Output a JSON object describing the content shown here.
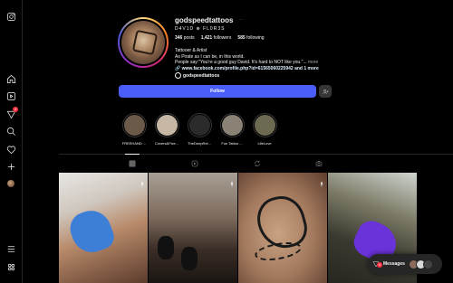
{
  "sidebar": {
    "icons": [
      "instagram-logo-icon",
      "home-icon",
      "reels-icon",
      "notifications-icon",
      "search-icon",
      "heart-icon",
      "create-icon",
      "profile-avatar",
      "menu-icon",
      "threads-icon"
    ],
    "notification_badge": "2"
  },
  "profile": {
    "username": "godspeedtattoos",
    "display_name": "D4V1D ⊕ FL0R3S",
    "stats": {
      "posts_count": "346",
      "posts_label": "posts",
      "followers_count": "1,421",
      "followers_label": "followers",
      "following_count": "585",
      "following_label": "following"
    },
    "bio_line1": "Tattooer & Artist",
    "bio_line2": "As Pirate as I can be, in this world.",
    "bio_line3": "People say:\"You're a good guy David. It's hard to NOT like you.\"...",
    "bio_more": "more",
    "link": "www.facebook.com/profile.php?id=61565060225942 and 1 more",
    "threads_handle": "godspeedtattoos",
    "follow_button": "Follow"
  },
  "highlights": [
    {
      "label": "FREEHAND ...",
      "color": "#6b5a4a"
    },
    {
      "label": "Covers&Fixe...",
      "color": "#c7b8a5"
    },
    {
      "label": "TheDeepRel...",
      "color": "#2b2b2b"
    },
    {
      "label": "Fun Tattoo ...",
      "color": "#8a8375"
    },
    {
      "label": "LifeLove",
      "color": "#6d6a52"
    }
  ],
  "tabs": [
    "grid-icon",
    "reels-tab-icon",
    "reposts-icon",
    "tagged-icon"
  ],
  "messages": {
    "label": "Messages",
    "badge": "4"
  },
  "colors": {
    "accent": "#4a5df9",
    "badge": "#ff3040",
    "background": "#000000"
  }
}
